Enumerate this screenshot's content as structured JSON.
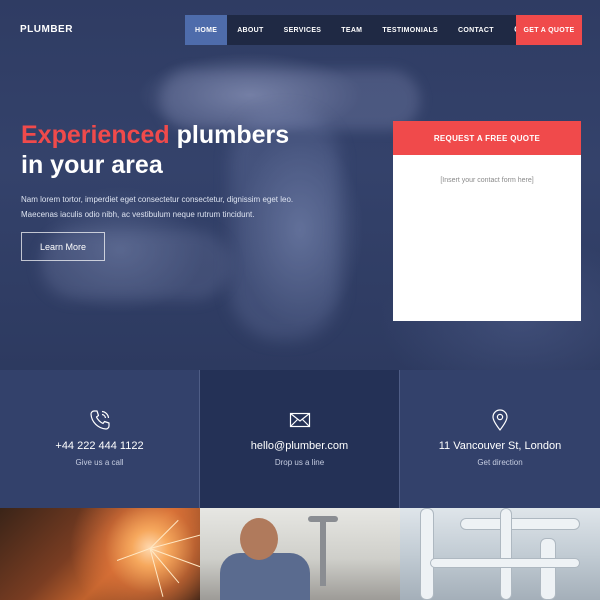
{
  "brand": "PLUMBER",
  "nav": {
    "items": [
      "HOME",
      "ABOUT",
      "SERVICES",
      "TEAM",
      "TESTIMONIALS",
      "CONTACT"
    ],
    "active": "HOME",
    "search_icon": "search-icon",
    "cta": "GET A QUOTE"
  },
  "hero": {
    "headline_accent": "Experienced",
    "headline_rest_1": " plumbers",
    "headline_line_2": "in your area",
    "description_1": "Nam lorem tortor, imperdiet eget consectetur consectetur, dignissim eget leo.",
    "description_2": "Maecenas iaculis odio nibh, ac vestibulum neque rutrum tincidunt.",
    "button": "Learn More"
  },
  "quote_form": {
    "title": "REQUEST A FREE QUOTE",
    "placeholder": "[Insert your contact form here]"
  },
  "contacts": [
    {
      "icon": "phone-icon",
      "value": "+44 222 444 1122",
      "label": "Give us a call"
    },
    {
      "icon": "envelope-icon",
      "value": "hello@plumber.com",
      "label": "Drop us a line"
    },
    {
      "icon": "location-pin-icon",
      "value": "11 Vancouver St, London",
      "label": "Get direction"
    }
  ],
  "colors": {
    "accent": "#f04a4b",
    "navy": "#2c3a5e",
    "nav_active": "#4e6cab"
  }
}
